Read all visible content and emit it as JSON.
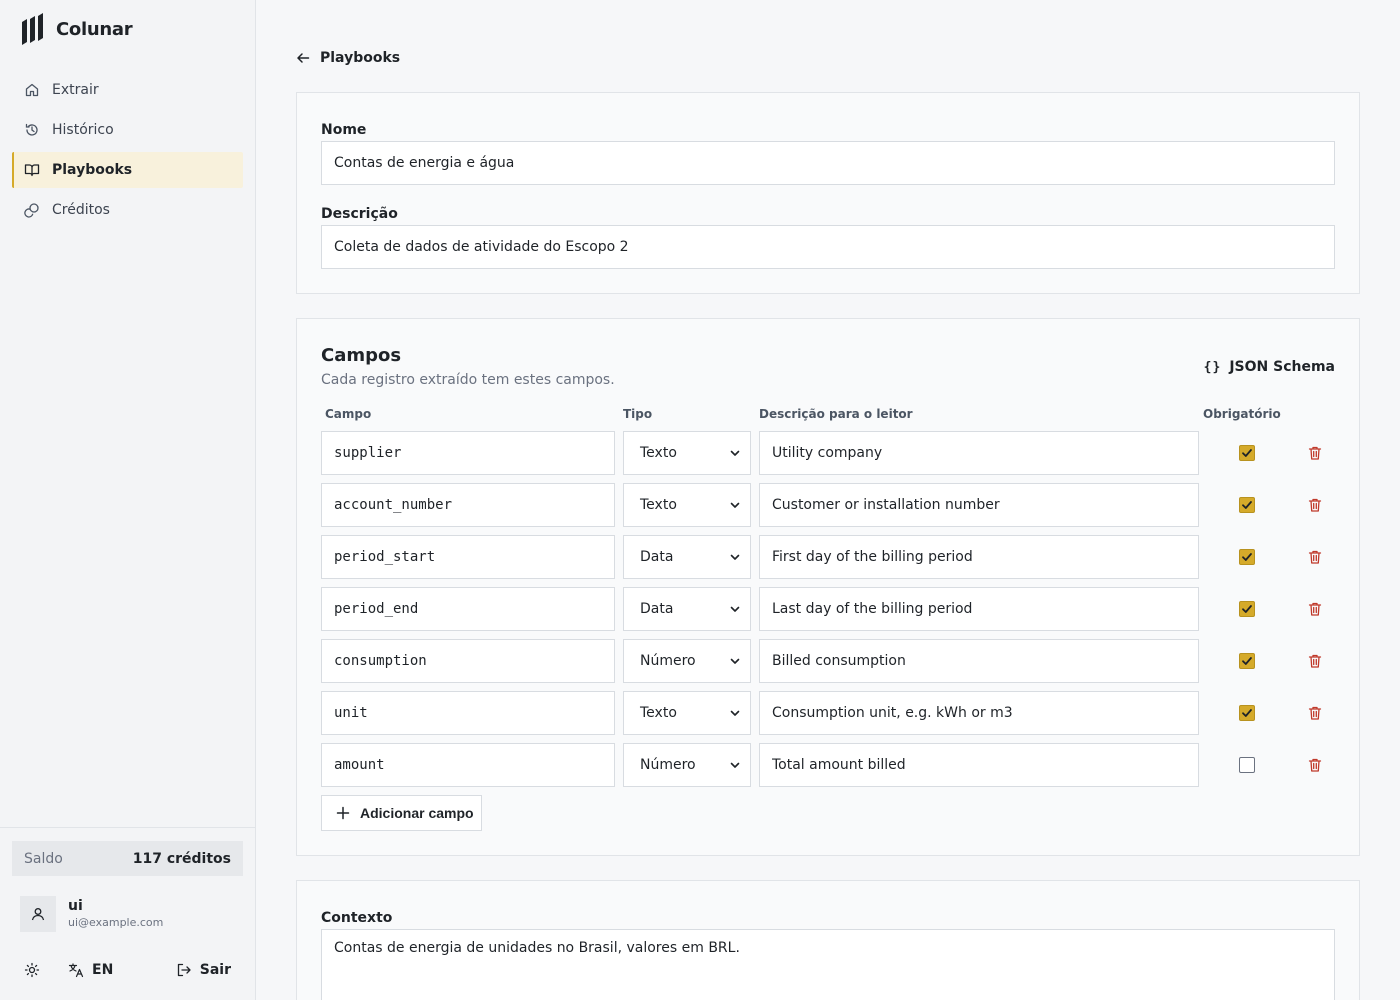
{
  "app": {
    "name": "Colunar"
  },
  "sidebar": {
    "items": [
      {
        "label": "Extrair",
        "icon": "home-icon",
        "active": false
      },
      {
        "label": "Histórico",
        "icon": "history-icon",
        "active": false
      },
      {
        "label": "Playbooks",
        "icon": "book-icon",
        "active": true
      },
      {
        "label": "Créditos",
        "icon": "coins-icon",
        "active": false
      }
    ],
    "balance": {
      "label": "Saldo",
      "value": "117 créditos"
    },
    "user": {
      "name": "ui",
      "email": "ui@example.com"
    },
    "language": "EN",
    "logout": "Sair"
  },
  "main": {
    "back_label": "Playbooks",
    "name_label": "Nome",
    "name_value": "Contas de energia e água",
    "description_label": "Descrição",
    "description_value": "Coleta de dados de atividade do Escopo 2",
    "fields_section": {
      "title": "Campos",
      "subtitle": "Cada registro extraído tem estes campos.",
      "schema_button": "JSON Schema",
      "columns": {
        "field": "Campo",
        "type": "Tipo",
        "description": "Descrição para o leitor",
        "required": "Obrigatório"
      },
      "rows": [
        {
          "name": "supplier",
          "type": "Texto",
          "description": "Utility company",
          "required": true
        },
        {
          "name": "account_number",
          "type": "Texto",
          "description": "Customer or installation number",
          "required": true
        },
        {
          "name": "period_start",
          "type": "Data",
          "description": "First day of the billing period",
          "required": true
        },
        {
          "name": "period_end",
          "type": "Data",
          "description": "Last day of the billing period",
          "required": true
        },
        {
          "name": "consumption",
          "type": "Número",
          "description": "Billed consumption",
          "required": true
        },
        {
          "name": "unit",
          "type": "Texto",
          "description": "Consumption unit, e.g. kWh or m3",
          "required": true
        },
        {
          "name": "amount",
          "type": "Número",
          "description": "Total amount billed",
          "required": false
        }
      ],
      "add_button": "Adicionar campo"
    },
    "context_label": "Contexto",
    "context_value": "Contas de energia de unidades no Brasil, valores em BRL."
  },
  "colors": {
    "accent": "#d5aa2a",
    "active_bg": "#f8f1dc",
    "danger": "#c0392b"
  }
}
